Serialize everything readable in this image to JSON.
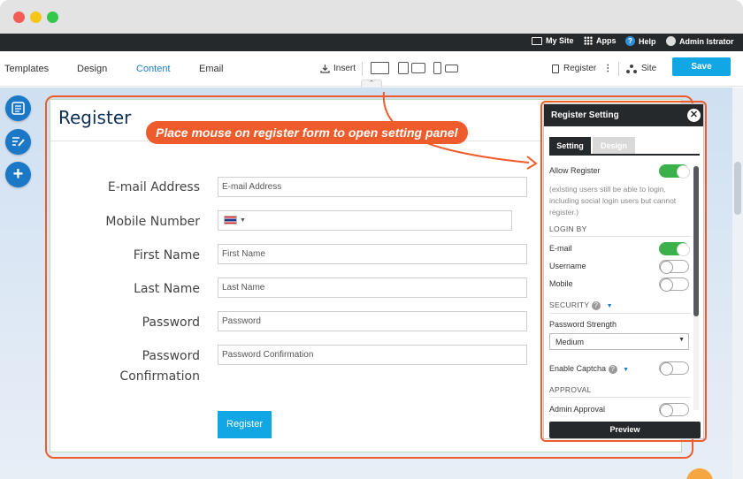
{
  "admin_bar": {
    "my_site": "My Site",
    "apps": "Apps",
    "help": "Help",
    "user": "Admin Istrator"
  },
  "toolbar": {
    "templates": "Templates",
    "design": "Design",
    "content": "Content",
    "email": "Email",
    "insert": "Insert",
    "register": "Register",
    "site": "Site",
    "save": "Save"
  },
  "colors": {
    "accent": "#11a6e4",
    "highlight": "#ef5c2b",
    "dark": "#26292c",
    "toggle_on": "#3bb14a"
  },
  "callout": "Place mouse on register form to open setting panel",
  "form": {
    "title": "Register",
    "fields": [
      {
        "label": "E-mail Address",
        "placeholder": "E-mail Address"
      },
      {
        "label": "Mobile Number",
        "placeholder": ""
      },
      {
        "label": "First Name",
        "placeholder": "First Name"
      },
      {
        "label": "Last Name",
        "placeholder": "Last Name"
      },
      {
        "label": "Password",
        "placeholder": "Password"
      },
      {
        "label_line1": "Password",
        "label_line2": "Confirmation",
        "placeholder": "Password Confirmation"
      }
    ],
    "submit": "Register"
  },
  "panel": {
    "title": "Register Setting",
    "tabs": [
      "Setting",
      "Design"
    ],
    "allow_register": {
      "label": "Allow Register",
      "on": true
    },
    "allow_note": "(existing users still be able to login, including social login users but cannot register.)",
    "login_by": {
      "heading": "LOGIN BY",
      "items": [
        {
          "label": "E-mail",
          "on": true
        },
        {
          "label": "Username",
          "on": false
        },
        {
          "label": "Mobile",
          "on": false
        }
      ]
    },
    "security": {
      "heading": "SECURITY",
      "password_strength_label": "Password Strength",
      "password_strength_value": "Medium",
      "captcha_label": "Enable Captcha",
      "captcha_on": false
    },
    "approval": {
      "heading": "APPROVAL",
      "admin_approval_label": "Admin Approval",
      "admin_approval_on": false
    },
    "preview": "Preview"
  }
}
